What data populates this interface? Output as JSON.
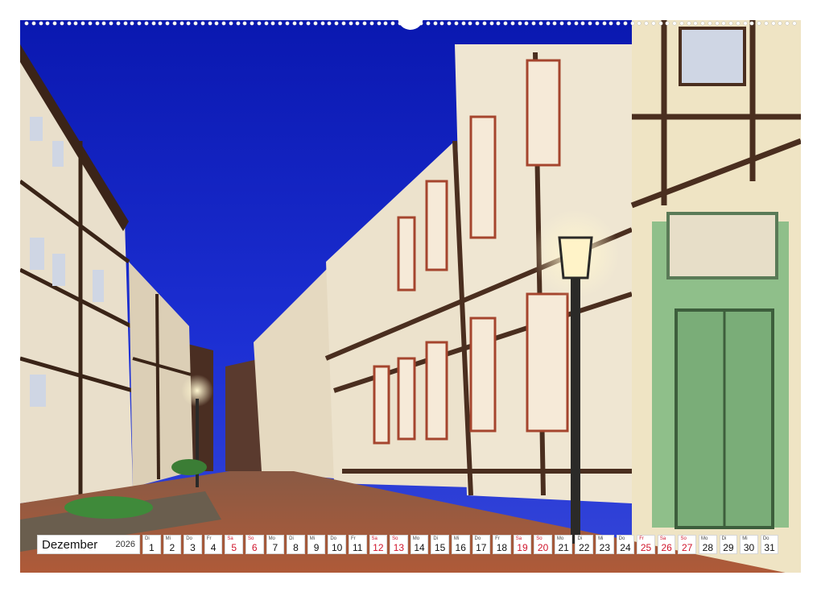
{
  "calendar": {
    "month": "Dezember",
    "year": "2026",
    "weekend_color": "#d0142b",
    "days": [
      {
        "dn": "Di",
        "dd": "1",
        "red": false
      },
      {
        "dn": "Mi",
        "dd": "2",
        "red": false
      },
      {
        "dn": "Do",
        "dd": "3",
        "red": false
      },
      {
        "dn": "Fr",
        "dd": "4",
        "red": false
      },
      {
        "dn": "Sa",
        "dd": "5",
        "red": true
      },
      {
        "dn": "So",
        "dd": "6",
        "red": true
      },
      {
        "dn": "Mo",
        "dd": "7",
        "red": false
      },
      {
        "dn": "Di",
        "dd": "8",
        "red": false
      },
      {
        "dn": "Mi",
        "dd": "9",
        "red": false
      },
      {
        "dn": "Do",
        "dd": "10",
        "red": false
      },
      {
        "dn": "Fr",
        "dd": "11",
        "red": false
      },
      {
        "dn": "Sa",
        "dd": "12",
        "red": true
      },
      {
        "dn": "So",
        "dd": "13",
        "red": true
      },
      {
        "dn": "Mo",
        "dd": "14",
        "red": false
      },
      {
        "dn": "Di",
        "dd": "15",
        "red": false
      },
      {
        "dn": "Mi",
        "dd": "16",
        "red": false
      },
      {
        "dn": "Do",
        "dd": "17",
        "red": false
      },
      {
        "dn": "Fr",
        "dd": "18",
        "red": false
      },
      {
        "dn": "Sa",
        "dd": "19",
        "red": true
      },
      {
        "dn": "So",
        "dd": "20",
        "red": true
      },
      {
        "dn": "Mo",
        "dd": "21",
        "red": false
      },
      {
        "dn": "Di",
        "dd": "22",
        "red": false
      },
      {
        "dn": "Mi",
        "dd": "23",
        "red": false
      },
      {
        "dn": "Do",
        "dd": "24",
        "red": false
      },
      {
        "dn": "Fr",
        "dd": "25",
        "red": true
      },
      {
        "dn": "Sa",
        "dd": "26",
        "red": true
      },
      {
        "dn": "So",
        "dd": "27",
        "red": true
      },
      {
        "dn": "Mo",
        "dd": "28",
        "red": false
      },
      {
        "dn": "Di",
        "dd": "29",
        "red": false
      },
      {
        "dn": "Mi",
        "dd": "30",
        "red": false
      },
      {
        "dn": "Do",
        "dd": "31",
        "red": false
      }
    ]
  },
  "photo": {
    "subject": "half-timbered-street-night-icon"
  },
  "colors": {
    "sky": "#1a2ad0",
    "cobblestone": "#a9583a",
    "timber": "#4a2e1f",
    "plaster": "#efe6d2",
    "lamp_glow": "#fff3c8",
    "door_green": "#8fbf8a"
  }
}
